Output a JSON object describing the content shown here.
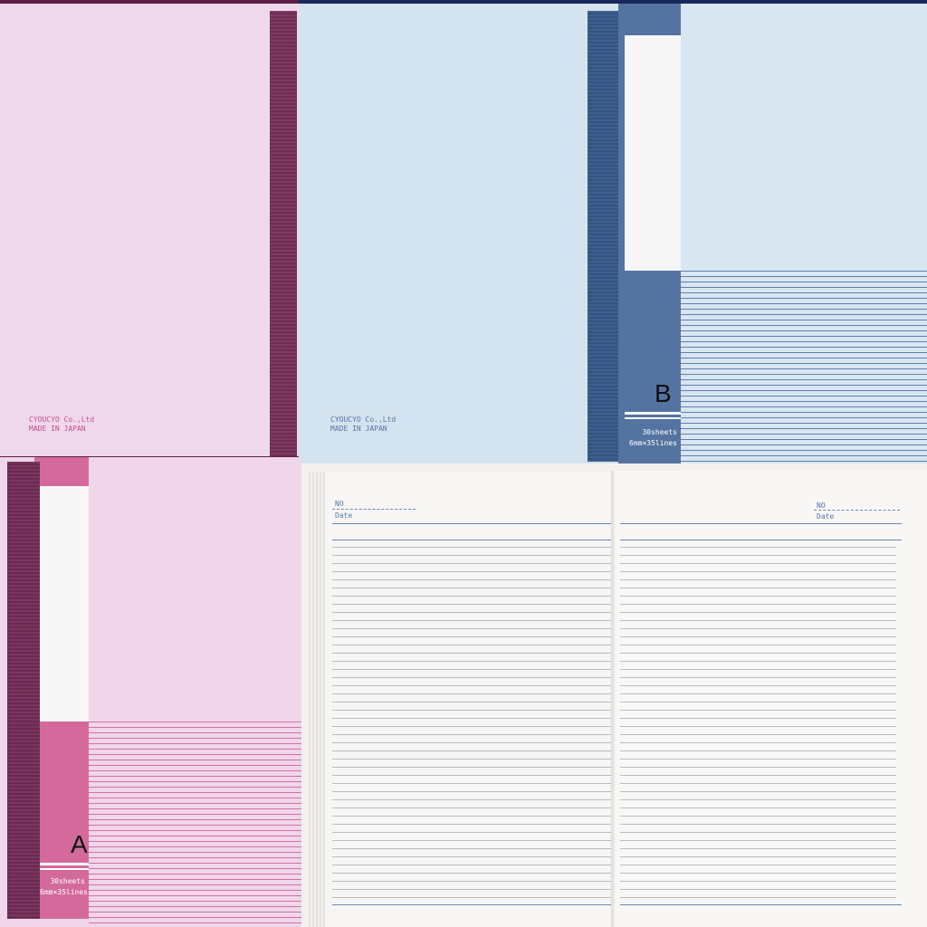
{
  "colors": {
    "pink_cover": "#efd8ec",
    "pink_accent": "#d46a9c",
    "pink_spine": "#7f3a62",
    "blue_cover": "#d3e3ef",
    "blue_accent": "#5473a0",
    "blue_spine": "#3e5f8f",
    "page_line": "#6a89b8"
  },
  "pink_back": {
    "maker_line1": "CYOUCYO Co.,Ltd",
    "maker_line2": "MADE IN JAPAN"
  },
  "blue_back": {
    "maker_line1": "CYOUCYO Co.,Ltd",
    "maker_line2": "MADE IN JAPAN"
  },
  "blue_front": {
    "letter": "B",
    "sheets": "30sheets",
    "ruling": "6mm×35lines"
  },
  "pink_front": {
    "letter": "A",
    "sheets": "30sheets",
    "ruling": "6mm×35lines"
  },
  "spread": {
    "left_no_label": "NO",
    "left_date_label": "Date",
    "right_no_label": "NO",
    "right_date_label": "Date"
  }
}
